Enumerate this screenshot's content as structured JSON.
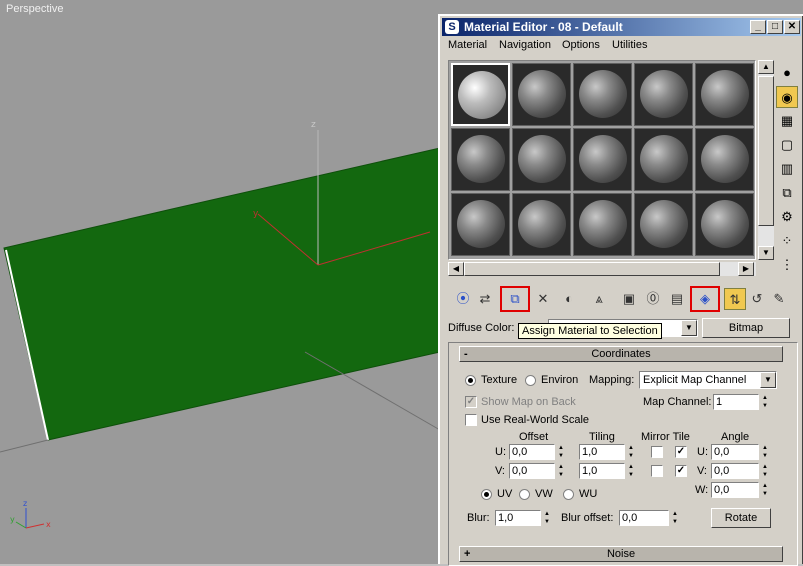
{
  "viewport": {
    "label": "Perspective"
  },
  "window": {
    "title": "Material Editor - 08 - Default",
    "controls": {
      "minimize": "_",
      "maximize": "□",
      "close": "✕"
    },
    "menu": [
      "Material",
      "Navigation",
      "Options",
      "Utilities"
    ]
  },
  "tooltip": {
    "text": "Assign Material to Selection"
  },
  "diffuse": {
    "label": "Diffuse Color:",
    "map_button": "Bitmap"
  },
  "coordinates": {
    "header": "Coordinates",
    "collapse_sign": "-",
    "texture_label": "Texture",
    "environ_label": "Environ",
    "mapping_label": "Mapping:",
    "mapping_value": "Explicit Map Channel",
    "show_map_on_back": "Show Map on Back",
    "map_channel_label": "Map Channel:",
    "map_channel_value": "1",
    "use_real_world": "Use Real-World Scale",
    "offset_label": "Offset",
    "tiling_label": "Tiling",
    "mirror_tile_label": "Mirror Tile",
    "angle_label": "Angle",
    "u_label": "U:",
    "v_label": "V:",
    "w_label": "W:",
    "offset_u": "0,0",
    "offset_v": "0,0",
    "tiling_u": "1,0",
    "tiling_v": "1,0",
    "angle_u": "0,0",
    "angle_v": "0,0",
    "angle_w": "0,0",
    "uv_label": "UV",
    "vw_label": "VW",
    "wu_label": "WU",
    "blur_label": "Blur:",
    "blur_value": "1,0",
    "blur_offset_label": "Blur offset:",
    "blur_offset_value": "0,0",
    "rotate_button": "Rotate"
  },
  "noise": {
    "header": "Noise",
    "expand_sign": "+"
  },
  "colors": {
    "viewport_bg": "#9a9a9a",
    "plane": "#13680f",
    "titlebar": "#0a246a",
    "highlight": "#e00000"
  }
}
